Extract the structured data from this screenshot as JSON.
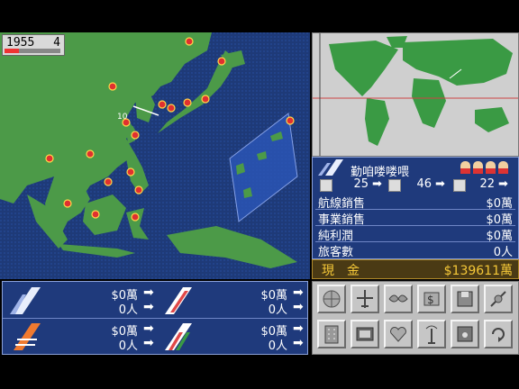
{
  "date": {
    "year": "1955",
    "month": "4",
    "progress": 0.25
  },
  "map": {
    "route_label": "10"
  },
  "airline": {
    "name": "勤咱喽喽喂",
    "counts": [
      "25",
      "46",
      "22"
    ],
    "rows": [
      {
        "label": "航線銷售",
        "value": "$0萬"
      },
      {
        "label": "事業銷售",
        "value": "$0萬"
      },
      {
        "label": "純利潤",
        "value": "$0萬"
      },
      {
        "label": "旅客數",
        "value": "0人"
      }
    ]
  },
  "cash": {
    "label": "現金",
    "value": "$139611萬"
  },
  "routes": {
    "left": [
      {
        "money": "$0萬",
        "people": "0人"
      },
      {
        "money": "$0萬",
        "people": "0人"
      }
    ],
    "right": [
      {
        "money": "$0萬",
        "people": "0人"
      },
      {
        "money": "$0萬",
        "people": "0人"
      }
    ]
  },
  "commands": [
    "globe-icon",
    "plane-icon",
    "wings-icon",
    "money-icon",
    "disk-icon",
    "satellite-icon",
    "building-icon",
    "tv-icon",
    "heart-icon",
    "antenna-icon",
    "diskette-icon",
    "cycle-icon"
  ],
  "colors": {
    "sea": "#1e3a78",
    "land": "#4a9a4a",
    "panel": "#1f3a7c",
    "cash": "#f5c838"
  }
}
